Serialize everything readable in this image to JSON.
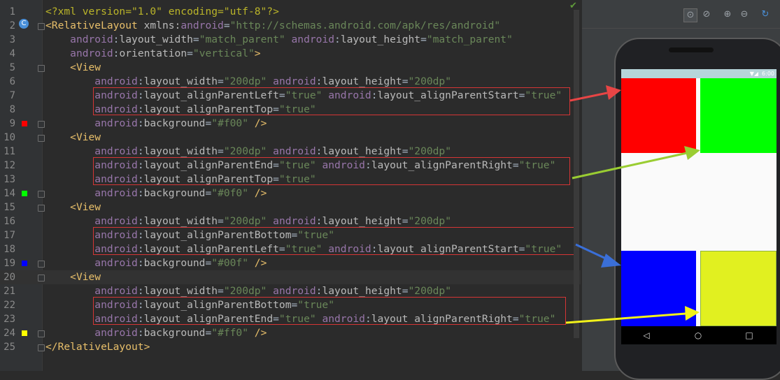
{
  "editor": {
    "lines": [
      {
        "n": "1",
        "s": [
          [
            "prolog",
            "<?xml version=\"1.0\" encoding=\"utf-8\"?>"
          ]
        ]
      },
      {
        "n": "2",
        "s": [
          [
            "tag",
            "<RelativeLayout "
          ],
          [
            "attr",
            "xmlns:"
          ],
          [
            "ns",
            "android"
          ],
          [
            "plain",
            "="
          ],
          [
            "val",
            "\"http://schemas.android.com/apk/res/android\""
          ]
        ]
      },
      {
        "n": "3",
        "s": [
          [
            "plain",
            "    "
          ],
          [
            "ns",
            "android"
          ],
          [
            "plain",
            ":"
          ],
          [
            "attr",
            "layout_width"
          ],
          [
            "plain",
            "="
          ],
          [
            "val",
            "\"match_parent\""
          ],
          [
            "plain",
            " "
          ],
          [
            "ns",
            "android"
          ],
          [
            "plain",
            ":"
          ],
          [
            "attr",
            "layout_height"
          ],
          [
            "plain",
            "="
          ],
          [
            "val",
            "\"match_parent\""
          ]
        ]
      },
      {
        "n": "4",
        "s": [
          [
            "plain",
            "    "
          ],
          [
            "ns",
            "android"
          ],
          [
            "plain",
            ":"
          ],
          [
            "attr",
            "orientation"
          ],
          [
            "plain",
            "="
          ],
          [
            "val",
            "\"vertical\""
          ],
          [
            "tag",
            ">"
          ]
        ]
      },
      {
        "n": "5",
        "s": [
          [
            "plain",
            "    "
          ],
          [
            "tag",
            "<View"
          ]
        ]
      },
      {
        "n": "6",
        "s": [
          [
            "plain",
            "        "
          ],
          [
            "ns",
            "android"
          ],
          [
            "plain",
            ":"
          ],
          [
            "attr",
            "layout_width"
          ],
          [
            "plain",
            "="
          ],
          [
            "val",
            "\"200dp\""
          ],
          [
            "plain",
            " "
          ],
          [
            "ns",
            "android"
          ],
          [
            "plain",
            ":"
          ],
          [
            "attr",
            "layout_height"
          ],
          [
            "plain",
            "="
          ],
          [
            "val",
            "\"200dp\""
          ]
        ]
      },
      {
        "n": "7",
        "s": [
          [
            "plain",
            "        "
          ],
          [
            "ns",
            "android"
          ],
          [
            "plain",
            ":"
          ],
          [
            "attr",
            "layout_alignParentLeft"
          ],
          [
            "plain",
            "="
          ],
          [
            "val",
            "\"true\""
          ],
          [
            "plain",
            " "
          ],
          [
            "ns",
            "android"
          ],
          [
            "plain",
            ":"
          ],
          [
            "attr",
            "layout_alignParentStart"
          ],
          [
            "plain",
            "="
          ],
          [
            "val",
            "\"true\""
          ]
        ]
      },
      {
        "n": "8",
        "s": [
          [
            "plain",
            "        "
          ],
          [
            "ns",
            "android"
          ],
          [
            "plain",
            ":"
          ],
          [
            "attr",
            "layout_alignParentTop"
          ],
          [
            "plain",
            "="
          ],
          [
            "val",
            "\"true\""
          ]
        ]
      },
      {
        "n": "9",
        "s": [
          [
            "plain",
            "        "
          ],
          [
            "ns",
            "android"
          ],
          [
            "plain",
            ":"
          ],
          [
            "attr",
            "background"
          ],
          [
            "plain",
            "="
          ],
          [
            "val",
            "\"#f00\""
          ],
          [
            "plain",
            " "
          ],
          [
            "tag",
            "/>"
          ]
        ]
      },
      {
        "n": "10",
        "s": [
          [
            "plain",
            "    "
          ],
          [
            "tag",
            "<View"
          ]
        ]
      },
      {
        "n": "11",
        "s": [
          [
            "plain",
            "        "
          ],
          [
            "ns",
            "android"
          ],
          [
            "plain",
            ":"
          ],
          [
            "attr",
            "layout_width"
          ],
          [
            "plain",
            "="
          ],
          [
            "val",
            "\"200dp\""
          ],
          [
            "plain",
            " "
          ],
          [
            "ns",
            "android"
          ],
          [
            "plain",
            ":"
          ],
          [
            "attr",
            "layout_height"
          ],
          [
            "plain",
            "="
          ],
          [
            "val",
            "\"200dp\""
          ]
        ]
      },
      {
        "n": "12",
        "s": [
          [
            "plain",
            "        "
          ],
          [
            "ns",
            "android"
          ],
          [
            "plain",
            ":"
          ],
          [
            "attr",
            "layout_alignParentEnd"
          ],
          [
            "plain",
            "="
          ],
          [
            "val",
            "\"true\""
          ],
          [
            "plain",
            " "
          ],
          [
            "ns",
            "android"
          ],
          [
            "plain",
            ":"
          ],
          [
            "attr",
            "layout_alignParentRight"
          ],
          [
            "plain",
            "="
          ],
          [
            "val",
            "\"true\""
          ]
        ]
      },
      {
        "n": "13",
        "s": [
          [
            "plain",
            "        "
          ],
          [
            "ns",
            "android"
          ],
          [
            "plain",
            ":"
          ],
          [
            "attr",
            "layout_alignParentTop"
          ],
          [
            "plain",
            "="
          ],
          [
            "val",
            "\"true\""
          ]
        ]
      },
      {
        "n": "14",
        "s": [
          [
            "plain",
            "        "
          ],
          [
            "ns",
            "android"
          ],
          [
            "plain",
            ":"
          ],
          [
            "attr",
            "background"
          ],
          [
            "plain",
            "="
          ],
          [
            "val",
            "\"#0f0\""
          ],
          [
            "plain",
            " "
          ],
          [
            "tag",
            "/>"
          ]
        ]
      },
      {
        "n": "15",
        "s": [
          [
            "plain",
            "    "
          ],
          [
            "tag",
            "<View"
          ]
        ]
      },
      {
        "n": "16",
        "s": [
          [
            "plain",
            "        "
          ],
          [
            "ns",
            "android"
          ],
          [
            "plain",
            ":"
          ],
          [
            "attr",
            "layout_width"
          ],
          [
            "plain",
            "="
          ],
          [
            "val",
            "\"200dp\""
          ],
          [
            "plain",
            " "
          ],
          [
            "ns",
            "android"
          ],
          [
            "plain",
            ":"
          ],
          [
            "attr",
            "layout_height"
          ],
          [
            "plain",
            "="
          ],
          [
            "val",
            "\"200dp\""
          ]
        ]
      },
      {
        "n": "17",
        "s": [
          [
            "plain",
            "        "
          ],
          [
            "ns",
            "android"
          ],
          [
            "plain",
            ":"
          ],
          [
            "attr",
            "layout_alignParentBottom"
          ],
          [
            "plain",
            "="
          ],
          [
            "val",
            "\"true\""
          ]
        ]
      },
      {
        "n": "18",
        "s": [
          [
            "plain",
            "        "
          ],
          [
            "ns",
            "android"
          ],
          [
            "plain",
            ":"
          ],
          [
            "attr",
            "layout_alignParentLeft"
          ],
          [
            "plain",
            "="
          ],
          [
            "val",
            "\"true\""
          ],
          [
            "plain",
            " "
          ],
          [
            "ns",
            "android"
          ],
          [
            "plain",
            ":"
          ],
          [
            "attr",
            "layout_alignParentStart"
          ],
          [
            "plain",
            "="
          ],
          [
            "val",
            "\"true\""
          ]
        ]
      },
      {
        "n": "19",
        "s": [
          [
            "plain",
            "        "
          ],
          [
            "ns",
            "android"
          ],
          [
            "plain",
            ":"
          ],
          [
            "attr",
            "background"
          ],
          [
            "plain",
            "="
          ],
          [
            "val",
            "\"#00f\""
          ],
          [
            "plain",
            " "
          ],
          [
            "tag",
            "/>"
          ]
        ]
      },
      {
        "n": "20",
        "s": [
          [
            "plain",
            "    "
          ],
          [
            "tag",
            "<View"
          ]
        ]
      },
      {
        "n": "21",
        "s": [
          [
            "plain",
            "        "
          ],
          [
            "ns",
            "android"
          ],
          [
            "plain",
            ":"
          ],
          [
            "attr",
            "layout_width"
          ],
          [
            "plain",
            "="
          ],
          [
            "val",
            "\"200dp\""
          ],
          [
            "plain",
            " "
          ],
          [
            "ns",
            "android"
          ],
          [
            "plain",
            ":"
          ],
          [
            "attr",
            "layout_height"
          ],
          [
            "plain",
            "="
          ],
          [
            "val",
            "\"200dp\""
          ]
        ]
      },
      {
        "n": "22",
        "s": [
          [
            "plain",
            "        "
          ],
          [
            "ns",
            "android"
          ],
          [
            "plain",
            ":"
          ],
          [
            "attr",
            "layout_alignParentBottom"
          ],
          [
            "plain",
            "="
          ],
          [
            "val",
            "\"true\""
          ]
        ]
      },
      {
        "n": "23",
        "s": [
          [
            "plain",
            "        "
          ],
          [
            "ns",
            "android"
          ],
          [
            "plain",
            ":"
          ],
          [
            "attr",
            "layout_alignParentEnd"
          ],
          [
            "plain",
            "="
          ],
          [
            "val",
            "\"true\""
          ],
          [
            "plain",
            " "
          ],
          [
            "ns",
            "android"
          ],
          [
            "plain",
            ":"
          ],
          [
            "attr",
            "layout_alignParentRight"
          ],
          [
            "plain",
            "="
          ],
          [
            "val",
            "\"true\""
          ]
        ]
      },
      {
        "n": "24",
        "s": [
          [
            "plain",
            "        "
          ],
          [
            "ns",
            "android"
          ],
          [
            "plain",
            ":"
          ],
          [
            "attr",
            "background"
          ],
          [
            "plain",
            "="
          ],
          [
            "val",
            "\"#ff0\""
          ],
          [
            "plain",
            " "
          ],
          [
            "tag",
            "/>"
          ]
        ]
      },
      {
        "n": "25",
        "s": [
          [
            "tag",
            "</RelativeLayout>"
          ]
        ]
      }
    ],
    "current_line": "20",
    "color_markers": [
      {
        "line": "9",
        "color": "#ff0000"
      },
      {
        "line": "14",
        "color": "#00ff00"
      },
      {
        "line": "19",
        "color": "#0000ff"
      },
      {
        "line": "24",
        "color": "#ffff00"
      }
    ],
    "class_icon_label": "C",
    "status_icon": "check-icon"
  },
  "preview_toolbar": {
    "buttons": [
      "zoom-fit-icon",
      "zoom-actual-icon",
      "zoom-in-icon",
      "zoom-out-icon",
      "refresh-icon"
    ]
  },
  "device": {
    "status_time": "6:00",
    "status_icons": "▼◢",
    "nav_back": "◁",
    "nav_home": "○",
    "nav_recent": "□",
    "views": [
      {
        "name": "red-view",
        "color": "#ff0000"
      },
      {
        "name": "green-view",
        "color": "#00ff00"
      },
      {
        "name": "blue-view",
        "color": "#0000ff"
      },
      {
        "name": "yellow-view",
        "color": "#e1f020"
      }
    ]
  },
  "colors": {
    "highlight_box": "#d53535",
    "arrow_red": "#e84545",
    "arrow_green": "#9acd32",
    "arrow_blue": "#3a6fd8",
    "arrow_yellow": "#f2f21a"
  }
}
